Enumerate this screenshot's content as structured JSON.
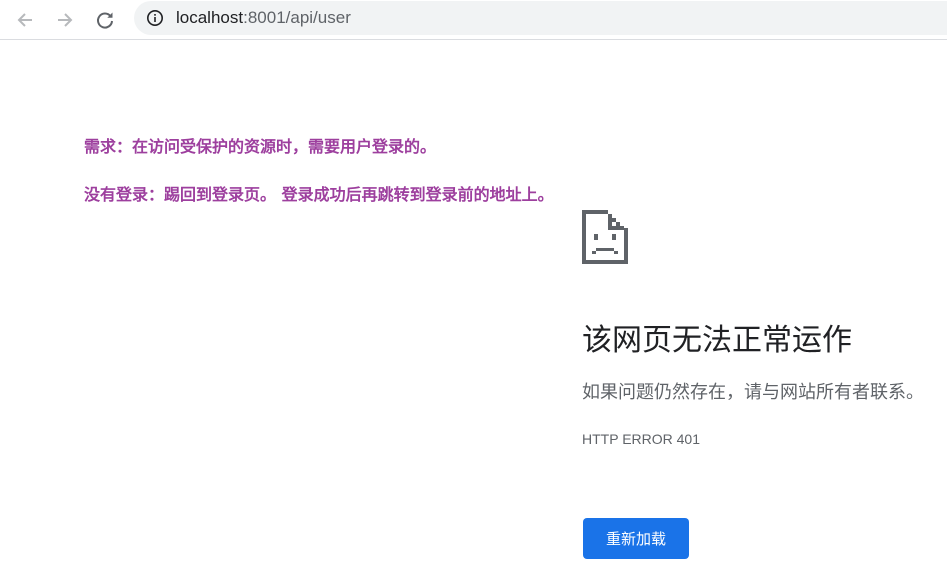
{
  "browser": {
    "back_icon": "arrow-left-icon",
    "forward_icon": "arrow-right-icon",
    "reload_icon": "reload-icon",
    "site_info_icon": "info-circle-icon",
    "url_host": "localhost",
    "url_rest": ":8001/api/user"
  },
  "annotations": {
    "line1": "需求：在访问受保护的资源时，需要用户登录的。",
    "line2": "没有登录：踢回到登录页。 登录成功后再跳转到登录前的地址上。",
    "color": "#9d3f9e"
  },
  "error_page": {
    "icon": "sad-document-icon",
    "title": "该网页无法正常运作",
    "description": "如果问题仍然存在，请与网站所有者联系。",
    "error_code": "HTTP ERROR 401",
    "reload_label": "重新加载",
    "accent_color": "#1a73e8"
  }
}
